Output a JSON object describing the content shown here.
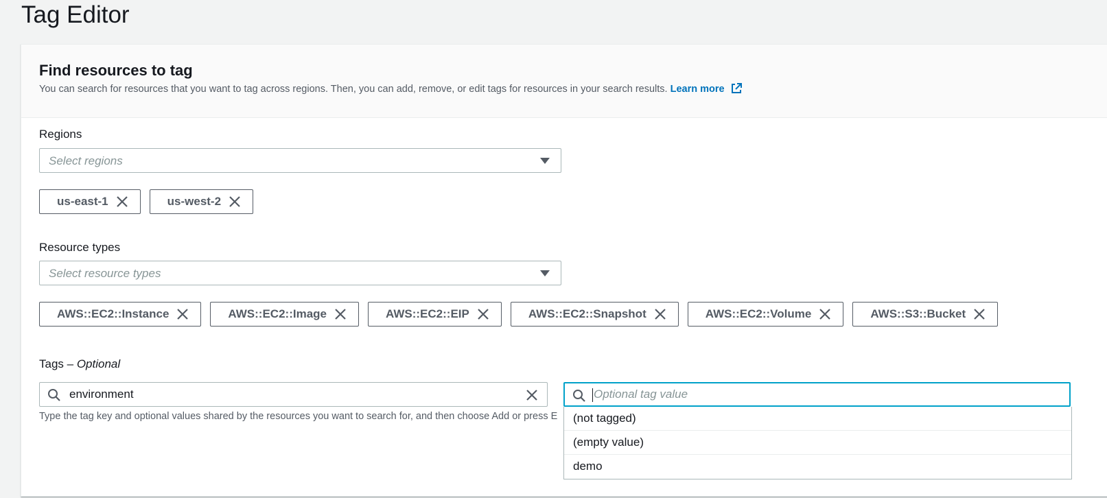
{
  "page": {
    "title": "Tag Editor"
  },
  "card": {
    "title": "Find resources to tag",
    "description": "You can search for resources that you want to tag across regions. Then, you can add, remove, or edit tags for resources in your search results.",
    "learn_more": "Learn more"
  },
  "regions": {
    "label": "Regions",
    "placeholder": "Select regions",
    "selected": [
      "us-east-1",
      "us-west-2"
    ]
  },
  "resource_types": {
    "label": "Resource types",
    "placeholder": "Select resource types",
    "selected": [
      "AWS::EC2::Instance",
      "AWS::EC2::Image",
      "AWS::EC2::EIP",
      "AWS::EC2::Snapshot",
      "AWS::EC2::Volume",
      "AWS::S3::Bucket"
    ]
  },
  "tags": {
    "label": "Tags – ",
    "label_optional": "Optional",
    "key_value": "environment",
    "value_placeholder": "Optional tag value",
    "hint": "Type the tag key and optional values shared by the resources you want to search for, and then choose Add or press E",
    "value_options": [
      "(not tagged)",
      "(empty value)",
      "demo"
    ]
  },
  "colors": {
    "accent": "#00a1c9",
    "link": "#0073bb",
    "token_border": "#545b64"
  },
  "icons": {
    "dropdown": "caret-down-icon",
    "remove": "close-icon",
    "search": "search-icon",
    "external": "external-link-icon"
  }
}
